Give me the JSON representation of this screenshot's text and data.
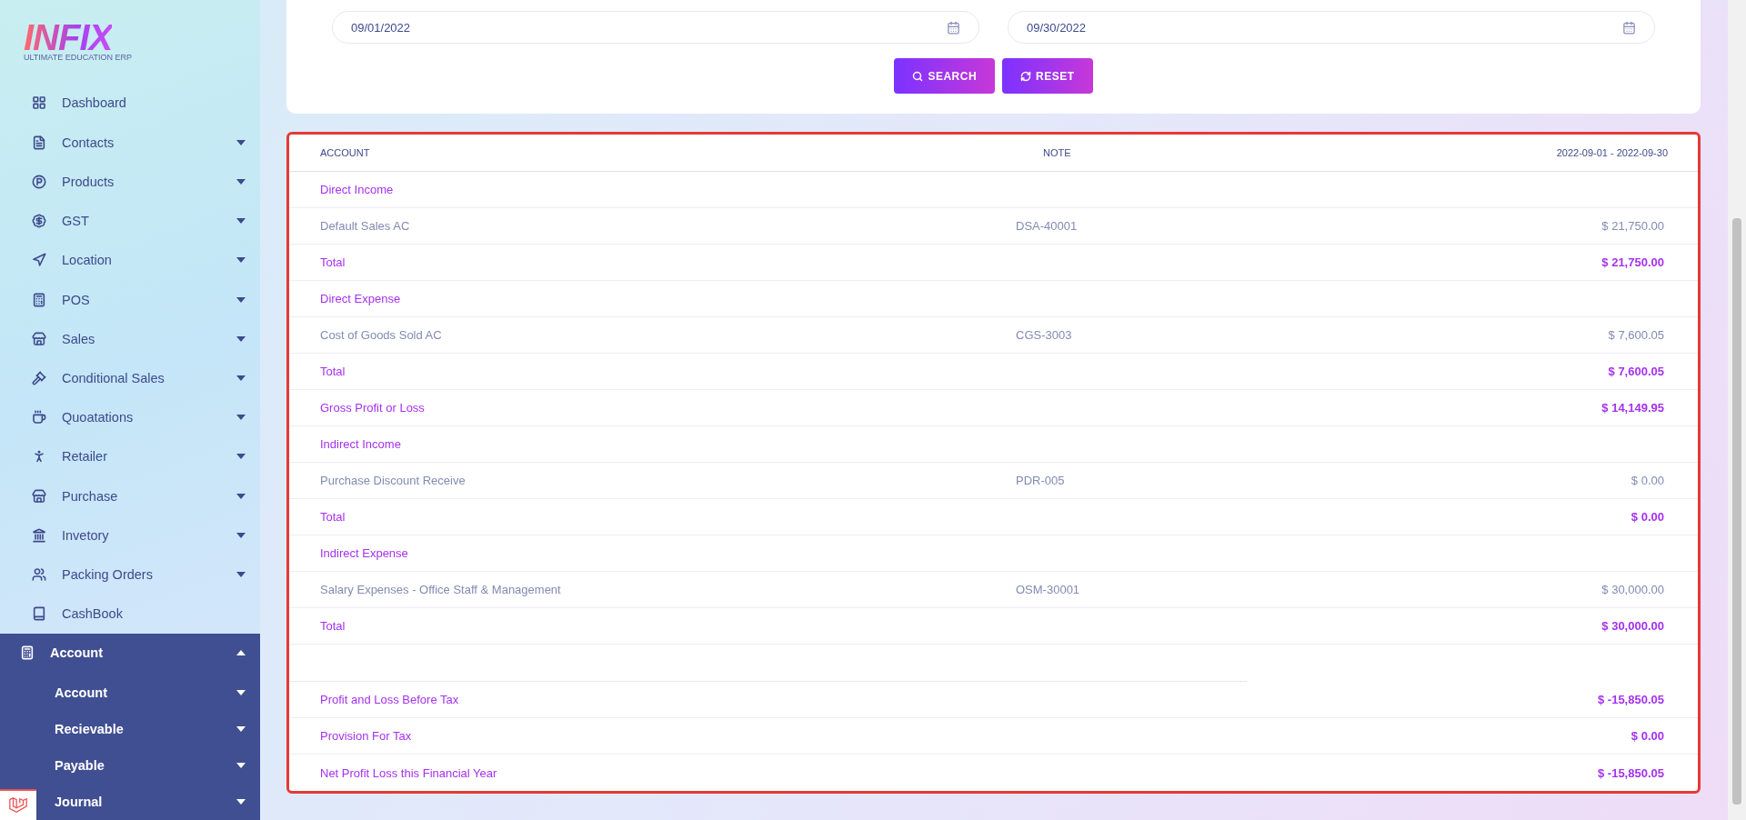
{
  "sidebar": {
    "logo": {
      "title": "INFIX",
      "subtitle": "ULTIMATE EDUCATION ERP"
    },
    "items": [
      {
        "label": "Dashboard",
        "kind": "link",
        "selected": false
      },
      {
        "label": "Contacts",
        "kind": "dropdown",
        "expanded": false,
        "selected": false
      },
      {
        "label": "Products",
        "kind": "dropdown",
        "expanded": false,
        "selected": false
      },
      {
        "label": "GST",
        "kind": "dropdown",
        "expanded": false,
        "selected": false
      },
      {
        "label": "Location",
        "kind": "dropdown",
        "expanded": false,
        "selected": false
      },
      {
        "label": "POS",
        "kind": "dropdown",
        "expanded": false,
        "selected": false
      },
      {
        "label": "Sales",
        "kind": "dropdown",
        "expanded": false,
        "selected": false
      },
      {
        "label": "Conditional Sales",
        "kind": "dropdown",
        "expanded": false,
        "selected": false
      },
      {
        "label": "Quoatations",
        "kind": "dropdown",
        "expanded": false,
        "selected": false
      },
      {
        "label": "Retailer",
        "kind": "dropdown",
        "expanded": false,
        "selected": false
      },
      {
        "label": "Purchase",
        "kind": "dropdown",
        "expanded": false,
        "selected": false
      },
      {
        "label": "Invetory",
        "kind": "dropdown",
        "expanded": false,
        "selected": false
      },
      {
        "label": "Packing Orders",
        "kind": "dropdown",
        "expanded": false,
        "selected": false
      },
      {
        "label": "CashBook",
        "kind": "link",
        "selected": false
      },
      {
        "label": "Account",
        "kind": "dropdown",
        "expanded": true,
        "selected": true,
        "children": [
          {
            "label": "Account",
            "expanded": false
          },
          {
            "label": "Recievable",
            "expanded": false
          },
          {
            "label": "Payable",
            "expanded": false
          },
          {
            "label": "Journal",
            "expanded": false
          }
        ]
      }
    ]
  },
  "filter": {
    "date_from": "09/01/2022",
    "date_to": "09/30/2022",
    "buttons": [
      {
        "label": "SEARCH",
        "kind": "search"
      },
      {
        "label": "RESET",
        "kind": "reset"
      }
    ]
  },
  "table": {
    "columns": [
      "ACCOUNT",
      "NOTE",
      "2022-09-01 - 2022-09-30"
    ],
    "rows": [
      {
        "kind": "group",
        "account": "Direct Income"
      },
      {
        "kind": "item",
        "account": "Default Sales AC",
        "note": "DSA-40001",
        "amount": "$ 21,750.00"
      },
      {
        "kind": "total",
        "account": "Total",
        "amount": "$ 21,750.00"
      },
      {
        "kind": "group",
        "account": "Direct Expense"
      },
      {
        "kind": "item",
        "account": "Cost of Goods Sold AC",
        "note": "CGS-3003",
        "amount": "$ 7,600.05"
      },
      {
        "kind": "total",
        "account": "Total",
        "amount": "$ 7,600.05"
      },
      {
        "kind": "total",
        "account": "Gross Profit or Loss",
        "amount": "$ 14,149.95"
      },
      {
        "kind": "group",
        "account": "Indirect Income"
      },
      {
        "kind": "item",
        "account": "Purchase Discount Receive",
        "note": "PDR-005",
        "amount": "$ 0.00"
      },
      {
        "kind": "total",
        "account": "Total",
        "amount": "$ 0.00"
      },
      {
        "kind": "group",
        "account": "Indirect Expense"
      },
      {
        "kind": "item",
        "account": "Salary Expenses - Office Staff & Management",
        "note": "OSM-30001",
        "amount": "$ 30,000.00"
      },
      {
        "kind": "total",
        "account": "Total",
        "amount": "$ 30,000.00"
      },
      {
        "kind": "spacer"
      },
      {
        "kind": "total",
        "account": "Profit and Loss Before Tax",
        "amount": "$ -15,850.05"
      },
      {
        "kind": "total",
        "account": "Provision For Tax",
        "amount": "$ 0.00"
      },
      {
        "kind": "total",
        "account": "Net Profit Loss this Financial Year",
        "amount": "$ -15,850.05"
      }
    ]
  }
}
